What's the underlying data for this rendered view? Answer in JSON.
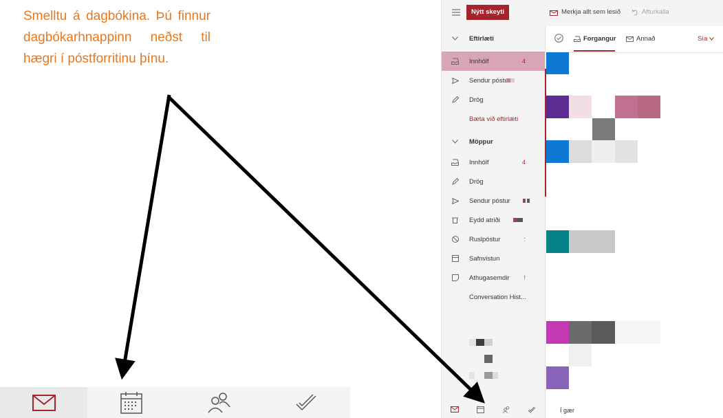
{
  "instruction": "Smelltu á dagbókina. Þú finnur dagbókarhnappinn neðst til hægri í póstforritinu þínu.",
  "colors": {
    "accent": "#a4262c",
    "instruction": "#e8781e",
    "selected": "#d8a5b6"
  },
  "big_nav": {
    "icons": [
      "mail-icon",
      "calendar-icon",
      "people-icon",
      "tasks-icon"
    ],
    "active": "mail-icon"
  },
  "app": {
    "toolbar": {
      "new_message": "Nýtt skeyti",
      "mark_all_read": "Merkja allt sem lesið",
      "undo": "Afturkalla"
    },
    "favorites": {
      "header": "Eftirlæti",
      "items": [
        {
          "label": "Innhólf",
          "count": "4",
          "icon": "inbox-icon"
        },
        {
          "label": "Sendur póstur",
          "icon": "sent-icon"
        },
        {
          "label": "Drög",
          "icon": "drafts-icon"
        }
      ],
      "add_favorite": "Bæta við eftirlæti"
    },
    "folders": {
      "header": "Möppur",
      "items": [
        {
          "label": "Innhólf",
          "count": "4",
          "icon": "inbox-icon"
        },
        {
          "label": "Drög",
          "icon": "drafts-icon"
        },
        {
          "label": "Sendur póstur",
          "icon": "sent-icon"
        },
        {
          "label": "Eydd atriði",
          "icon": "trash-icon"
        },
        {
          "label": "Ruslpóstur",
          "count": ":",
          "icon": "junk-icon"
        },
        {
          "label": "Safnvistun",
          "icon": "archive-icon"
        },
        {
          "label": "Athugasemdir",
          "count": "!",
          "icon": "notes-icon"
        },
        {
          "label": "Conversation Hist..."
        }
      ]
    },
    "tabs": {
      "focused": "Forgangur",
      "other": "Annað",
      "filter": "Sía"
    },
    "date_group": "Í gær",
    "bottom_nav": [
      "mail-icon",
      "calendar-icon",
      "people-icon",
      "tasks-icon"
    ]
  }
}
